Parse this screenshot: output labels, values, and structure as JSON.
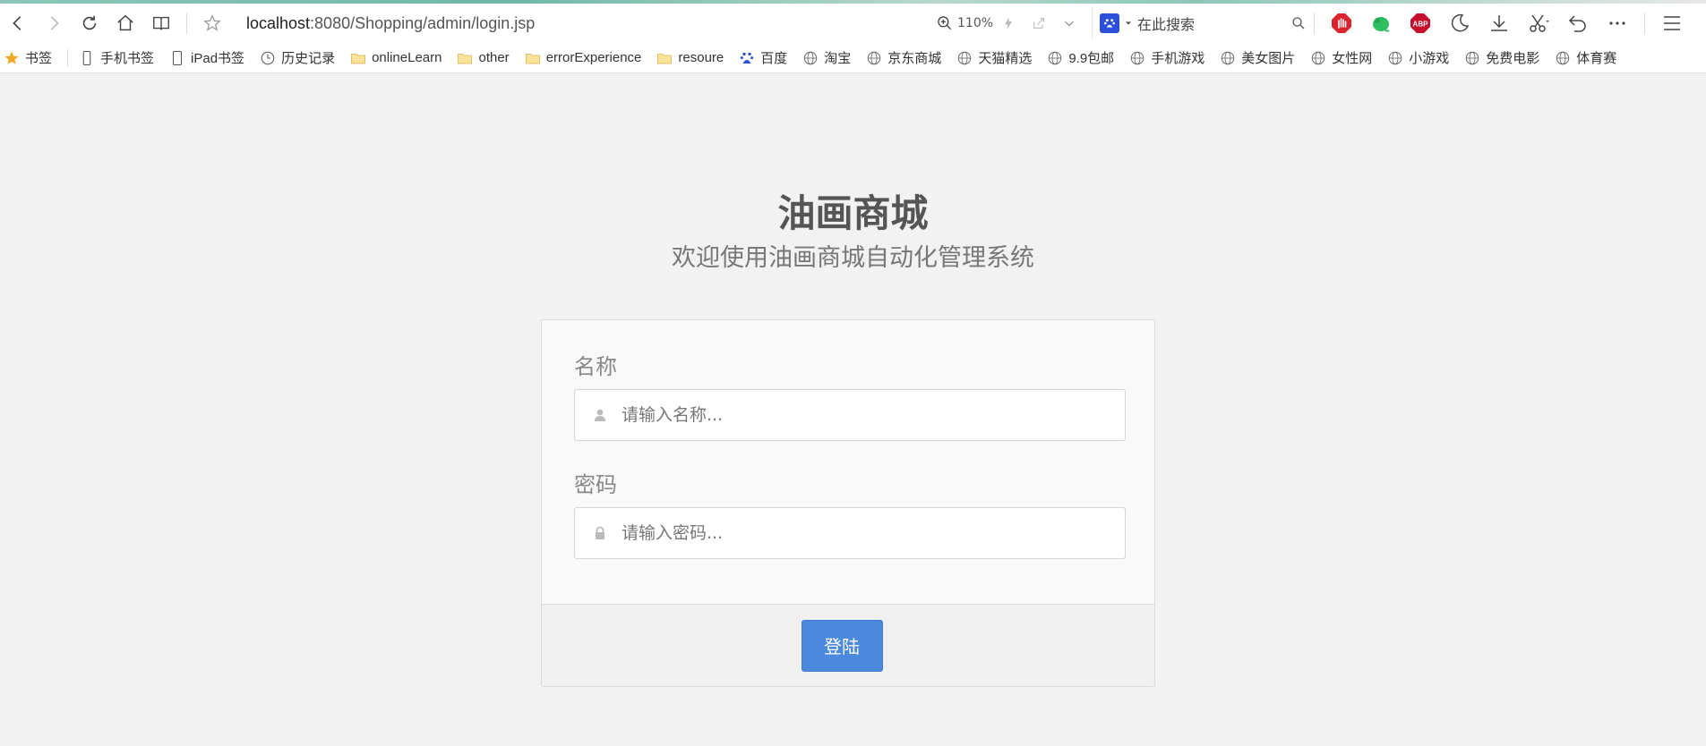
{
  "browser": {
    "url_host": "localhost",
    "url_rest": ":8080/Shopping/admin/login.jsp",
    "zoom_level": "110%",
    "search_placeholder": "在此搜索"
  },
  "bookmarks": {
    "bookmarks_label": "书签",
    "items": [
      {
        "label": "手机书签",
        "icon": "phone-icon"
      },
      {
        "label": "iPad书签",
        "icon": "tablet-icon"
      },
      {
        "label": "历史记录",
        "icon": "clock-icon"
      },
      {
        "label": "onlineLearn",
        "icon": "folder-icon"
      },
      {
        "label": "other",
        "icon": "folder-icon"
      },
      {
        "label": "errorExperience",
        "icon": "folder-icon"
      },
      {
        "label": "resoure",
        "icon": "folder-icon"
      },
      {
        "label": "百度",
        "icon": "baidu-paw-icon"
      },
      {
        "label": "淘宝",
        "icon": "globe-icon"
      },
      {
        "label": "京东商城",
        "icon": "globe-icon"
      },
      {
        "label": "天猫精选",
        "icon": "globe-icon"
      },
      {
        "label": "9.9包邮",
        "icon": "globe-icon"
      },
      {
        "label": "手机游戏",
        "icon": "globe-icon"
      },
      {
        "label": "美女图片",
        "icon": "globe-icon"
      },
      {
        "label": "女性网",
        "icon": "globe-icon"
      },
      {
        "label": "小游戏",
        "icon": "globe-icon"
      },
      {
        "label": "免费电影",
        "icon": "globe-icon"
      },
      {
        "label": "体育赛",
        "icon": "globe-icon"
      }
    ]
  },
  "page": {
    "title": "油画商城",
    "subtitle": "欢迎使用油画商城自动化管理系统"
  },
  "form": {
    "name_label": "名称",
    "name_placeholder": "请输入名称...",
    "password_label": "密码",
    "password_placeholder": "请输入密码...",
    "submit_label": "登陆"
  },
  "colors": {
    "accent": "#4a89dc",
    "background": "#f2f2f2",
    "panel": "#f9f9f9"
  }
}
